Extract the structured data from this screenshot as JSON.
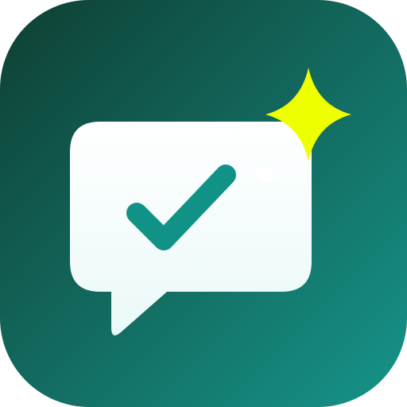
{
  "app_icon": {
    "name": "chat-check-sparkle-icon",
    "colors": {
      "background_start": "#0f3f33",
      "background_end": "#16948a",
      "bubble_top": "#ffffff",
      "bubble_bottom": "#eaf9f8",
      "checkmark": "#119287",
      "sparkle": "#eeff00"
    }
  }
}
